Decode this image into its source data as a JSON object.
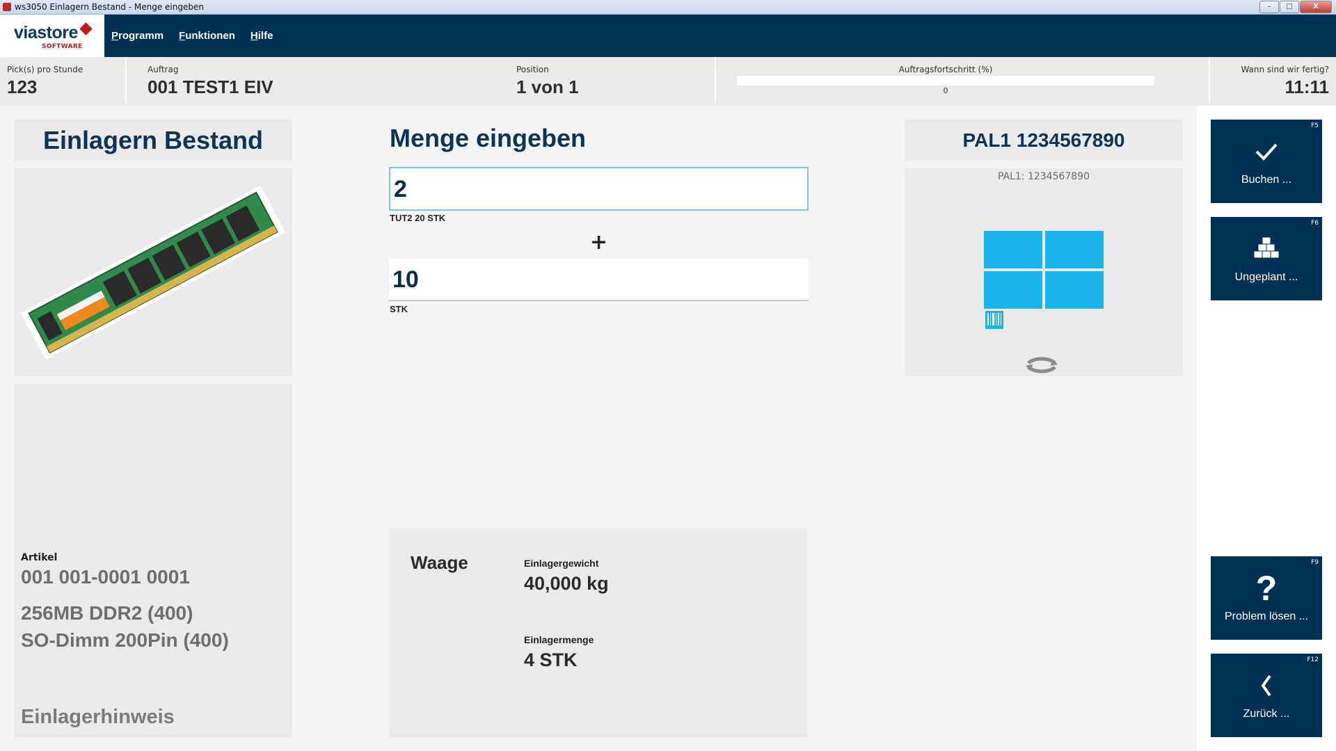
{
  "window": {
    "title": "ws3050 Einlagern Bestand - Menge eingeben",
    "minimize": "–",
    "maximize": "□",
    "close": "X"
  },
  "logo": {
    "brand": "viastore",
    "sub": "SOFTWARE"
  },
  "menu": [
    {
      "mnemonic": "P",
      "rest": "rogramm"
    },
    {
      "mnemonic": "F",
      "rest": "unktionen"
    },
    {
      "mnemonic": "H",
      "rest": "ilfe"
    }
  ],
  "info": {
    "picks_label": "Pick(s) pro Stunde",
    "picks_value": "123",
    "auftrag_label": "Auftrag",
    "auftrag_value": "001  TEST1  EIV",
    "position_label": "Position",
    "position_value": "1  von  1",
    "progress_label": "Auftragsfortschritt (%)",
    "progress_value": "0",
    "progress_percent": 0,
    "eta_label": "Wann sind wir fertig?",
    "eta_value": "11:11"
  },
  "left": {
    "title": "Einlagern Bestand",
    "artikel_label": "Artikel",
    "artikel_number": "001  001-0001  0001",
    "description_1": "256MB DDR2 (400)",
    "description_2": "SO-Dimm 200Pin (400)",
    "hinweis": "Einlagerhinweis"
  },
  "middle": {
    "title": "Menge eingeben",
    "input1_value": "2",
    "input1_unit": "TUT2  20  STK",
    "plus": "+",
    "input2_value": "10",
    "input2_unit": "STK",
    "waage": {
      "title": "Waage",
      "gewicht_label": "Einlagergewicht",
      "gewicht_value": "40,000  kg",
      "menge_label": "Einlagermenge",
      "menge_value": "4  STK"
    }
  },
  "right": {
    "title": "PAL1  1234567890",
    "subtitle": "PAL1: 1234567890"
  },
  "actions": [
    {
      "fkey": "F5",
      "label": "Buchen ...",
      "icon": "check-icon"
    },
    {
      "fkey": "F6",
      "label": "Ungeplant ...",
      "icon": "boxes-icon"
    },
    {
      "fkey": "F9",
      "label": "Problem lösen ...",
      "icon": "question-icon"
    },
    {
      "fkey": "F12",
      "label": "Zurück ...",
      "icon": "back-icon"
    }
  ],
  "colors": {
    "accent": "#003157",
    "tile": "#1ab3ea"
  }
}
